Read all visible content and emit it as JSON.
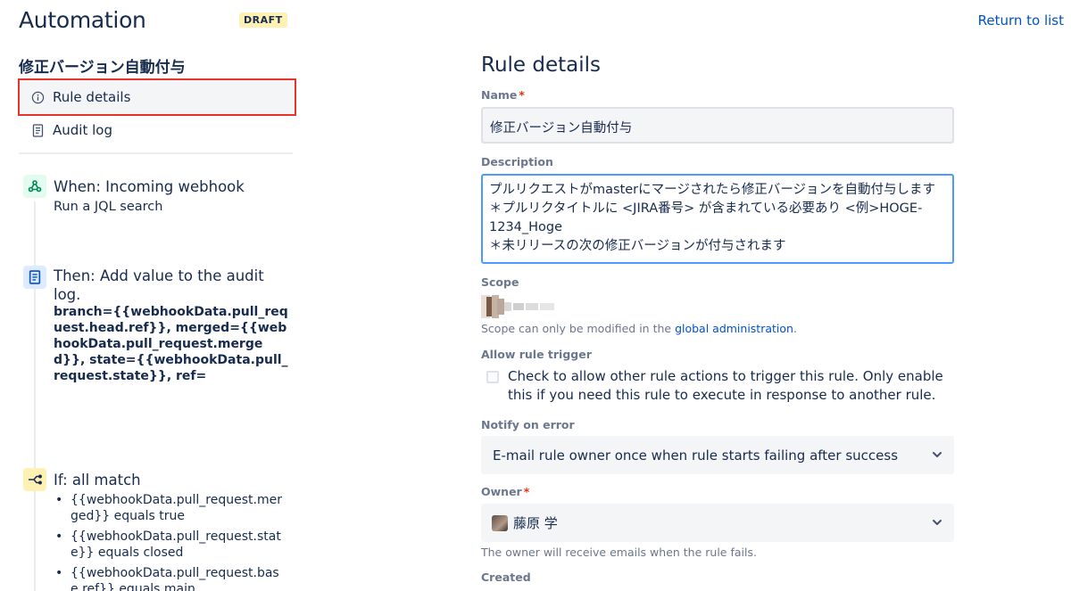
{
  "header": {
    "title": "Automation",
    "badge": "DRAFT",
    "return_link": "Return to list"
  },
  "sidebar": {
    "rule_name": "修正バージョン自動付与",
    "nav": [
      {
        "label": "Rule details",
        "icon": "info-icon",
        "selected": true
      },
      {
        "label": "Audit log",
        "icon": "document-icon",
        "selected": false
      }
    ],
    "steps": {
      "trigger": {
        "title": "When: Incoming webhook",
        "subtitle": "Run a JQL search",
        "icon": "webhook-icon"
      },
      "action": {
        "title": "Then: Add value to the audit log.",
        "body": "branch={{webhookData.pull_request.head.ref}}, merged={{webhookData.pull_request.merged}}, state={{webhookData.pull_request.state}}, ref=",
        "icon": "audit-log-icon"
      },
      "condition": {
        "title": "If: all match",
        "icon": "branch-icon",
        "items": [
          "{{webhookData.pull_request.merged}} equals true",
          "{{webhookData.pull_request.state}} equals closed",
          "{{webhookData.pull_request.base.ref}} equals main"
        ]
      }
    }
  },
  "details": {
    "title": "Rule details",
    "name_label": "Name",
    "name_value": "修正バージョン自動付与",
    "description_label": "Description",
    "description_lines": [
      "プルリクエストがmasterにマージされたら修正バージョンを自動付与します",
      "＊プルリクタイトルに <JIRA番号> が含まれている必要あり <例>HOGE-1234_Hoge",
      "＊未リリースの次の修正バージョンが付与されます"
    ],
    "scope_label": "Scope",
    "scope_help_prefix": "Scope can only be modified in the ",
    "scope_help_link": "global administration",
    "scope_help_suffix": ".",
    "allow_trigger_label": "Allow rule trigger",
    "allow_trigger_text": "Check to allow other rule actions to trigger this rule. Only enable this if you need this rule to execute in response to another rule.",
    "allow_trigger_checked": false,
    "notify_label": "Notify on error",
    "notify_value": "E-mail rule owner once when rule starts failing after success",
    "owner_label": "Owner",
    "owner_value": "藤原 学",
    "owner_help": "The owner will receive emails when the rule fails.",
    "created_label": "Created"
  },
  "colors": {
    "primary_text": "#172b4d",
    "link": "#0052cc",
    "selected_outline": "#e5342a",
    "required": "#de350b",
    "focus_border": "#4c9aff"
  }
}
